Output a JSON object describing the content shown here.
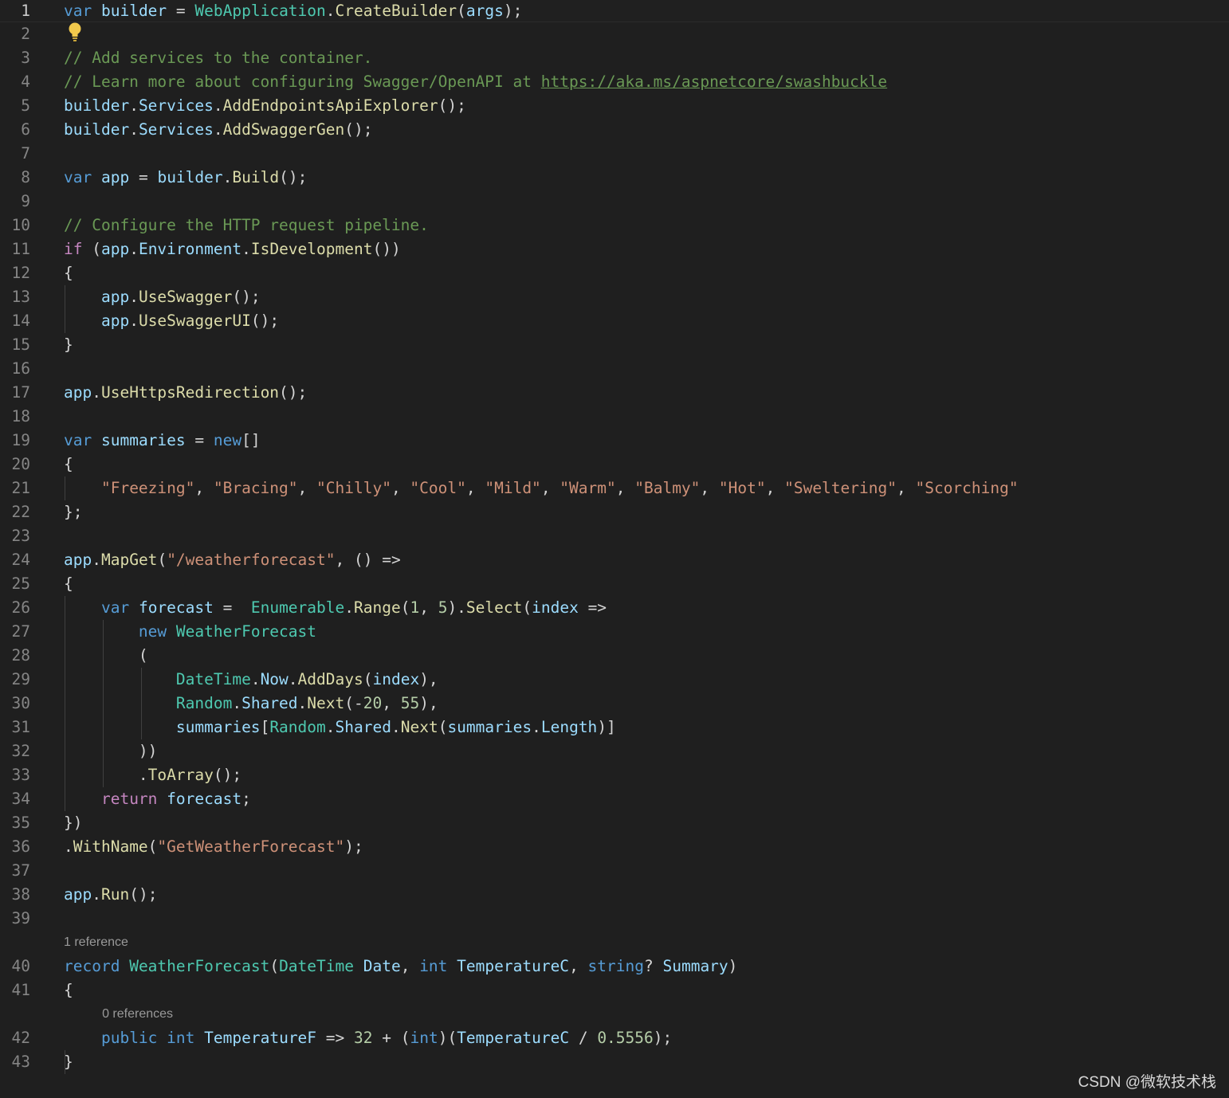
{
  "editor": {
    "language": "C#",
    "theme_colors": {
      "background": "#1f1f1f",
      "keyword": "#569cd6",
      "control": "#c586c0",
      "type": "#4ec9b0",
      "variable": "#9cdcfe",
      "function": "#dcdcaa",
      "string": "#ce9178",
      "number": "#b5cea8",
      "comment": "#6a9955",
      "punctuation": "#d4d4d4",
      "line_number": "#858585"
    },
    "current_line": 1,
    "lightbulb_icon": "lightbulb-icon",
    "lines": [
      {
        "n": "1",
        "tokens": [
          [
            "k",
            "var"
          ],
          [
            "p",
            " "
          ],
          [
            "v",
            "builder"
          ],
          [
            "p",
            " = "
          ],
          [
            "t",
            "WebApplication"
          ],
          [
            "p",
            "."
          ],
          [
            "f",
            "CreateBuilder"
          ],
          [
            "p",
            "("
          ],
          [
            "v",
            "args"
          ],
          [
            "p",
            ");"
          ]
        ]
      },
      {
        "n": "2",
        "tokens": []
      },
      {
        "n": "3",
        "tokens": [
          [
            "m",
            "// Add services to the container."
          ]
        ]
      },
      {
        "n": "4",
        "tokens": [
          [
            "m",
            "// Learn more about configuring Swagger/OpenAPI at "
          ],
          [
            "u",
            "https://aka.ms/aspnetcore/swashbuckle"
          ]
        ]
      },
      {
        "n": "5",
        "tokens": [
          [
            "v",
            "builder"
          ],
          [
            "p",
            "."
          ],
          [
            "v",
            "Services"
          ],
          [
            "p",
            "."
          ],
          [
            "f",
            "AddEndpointsApiExplorer"
          ],
          [
            "p",
            "();"
          ]
        ]
      },
      {
        "n": "6",
        "tokens": [
          [
            "v",
            "builder"
          ],
          [
            "p",
            "."
          ],
          [
            "v",
            "Services"
          ],
          [
            "p",
            "."
          ],
          [
            "f",
            "AddSwaggerGen"
          ],
          [
            "p",
            "();"
          ]
        ]
      },
      {
        "n": "7",
        "tokens": []
      },
      {
        "n": "8",
        "tokens": [
          [
            "k",
            "var"
          ],
          [
            "p",
            " "
          ],
          [
            "v",
            "app"
          ],
          [
            "p",
            " = "
          ],
          [
            "v",
            "builder"
          ],
          [
            "p",
            "."
          ],
          [
            "f",
            "Build"
          ],
          [
            "p",
            "();"
          ]
        ]
      },
      {
        "n": "9",
        "tokens": []
      },
      {
        "n": "10",
        "tokens": [
          [
            "m",
            "// Configure the HTTP request pipeline."
          ]
        ]
      },
      {
        "n": "11",
        "tokens": [
          [
            "c",
            "if"
          ],
          [
            "p",
            " ("
          ],
          [
            "v",
            "app"
          ],
          [
            "p",
            "."
          ],
          [
            "v",
            "Environment"
          ],
          [
            "p",
            "."
          ],
          [
            "f",
            "IsDevelopment"
          ],
          [
            "p",
            "())"
          ]
        ]
      },
      {
        "n": "12",
        "tokens": [
          [
            "p",
            "{"
          ]
        ]
      },
      {
        "n": "13",
        "tokens": [
          [
            "p",
            "    "
          ],
          [
            "v",
            "app"
          ],
          [
            "p",
            "."
          ],
          [
            "f",
            "UseSwagger"
          ],
          [
            "p",
            "();"
          ]
        ]
      },
      {
        "n": "14",
        "tokens": [
          [
            "p",
            "    "
          ],
          [
            "v",
            "app"
          ],
          [
            "p",
            "."
          ],
          [
            "f",
            "UseSwaggerUI"
          ],
          [
            "p",
            "();"
          ]
        ]
      },
      {
        "n": "15",
        "tokens": [
          [
            "p",
            "}"
          ]
        ]
      },
      {
        "n": "16",
        "tokens": []
      },
      {
        "n": "17",
        "tokens": [
          [
            "v",
            "app"
          ],
          [
            "p",
            "."
          ],
          [
            "f",
            "UseHttpsRedirection"
          ],
          [
            "p",
            "();"
          ]
        ]
      },
      {
        "n": "18",
        "tokens": []
      },
      {
        "n": "19",
        "tokens": [
          [
            "k",
            "var"
          ],
          [
            "p",
            " "
          ],
          [
            "v",
            "summaries"
          ],
          [
            "p",
            " = "
          ],
          [
            "k",
            "new"
          ],
          [
            "p",
            "[]"
          ]
        ]
      },
      {
        "n": "20",
        "tokens": [
          [
            "p",
            "{"
          ]
        ]
      },
      {
        "n": "21",
        "tokens": [
          [
            "p",
            "    "
          ],
          [
            "s",
            "\"Freezing\""
          ],
          [
            "p",
            ", "
          ],
          [
            "s",
            "\"Bracing\""
          ],
          [
            "p",
            ", "
          ],
          [
            "s",
            "\"Chilly\""
          ],
          [
            "p",
            ", "
          ],
          [
            "s",
            "\"Cool\""
          ],
          [
            "p",
            ", "
          ],
          [
            "s",
            "\"Mild\""
          ],
          [
            "p",
            ", "
          ],
          [
            "s",
            "\"Warm\""
          ],
          [
            "p",
            ", "
          ],
          [
            "s",
            "\"Balmy\""
          ],
          [
            "p",
            ", "
          ],
          [
            "s",
            "\"Hot\""
          ],
          [
            "p",
            ", "
          ],
          [
            "s",
            "\"Sweltering\""
          ],
          [
            "p",
            ", "
          ],
          [
            "s",
            "\"Scorching\""
          ]
        ]
      },
      {
        "n": "22",
        "tokens": [
          [
            "p",
            "};"
          ]
        ]
      },
      {
        "n": "23",
        "tokens": []
      },
      {
        "n": "24",
        "tokens": [
          [
            "v",
            "app"
          ],
          [
            "p",
            "."
          ],
          [
            "f",
            "MapGet"
          ],
          [
            "p",
            "("
          ],
          [
            "s",
            "\"/weatherforecast\""
          ],
          [
            "p",
            ", () =>"
          ]
        ]
      },
      {
        "n": "25",
        "tokens": [
          [
            "p",
            "{"
          ]
        ]
      },
      {
        "n": "26",
        "tokens": [
          [
            "p",
            "    "
          ],
          [
            "k",
            "var"
          ],
          [
            "p",
            " "
          ],
          [
            "v",
            "forecast"
          ],
          [
            "p",
            " =  "
          ],
          [
            "t",
            "Enumerable"
          ],
          [
            "p",
            "."
          ],
          [
            "f",
            "Range"
          ],
          [
            "p",
            "("
          ],
          [
            "n",
            "1"
          ],
          [
            "p",
            ", "
          ],
          [
            "n",
            "5"
          ],
          [
            "p",
            ")."
          ],
          [
            "f",
            "Select"
          ],
          [
            "p",
            "("
          ],
          [
            "v",
            "index"
          ],
          [
            "p",
            " =>"
          ]
        ]
      },
      {
        "n": "27",
        "tokens": [
          [
            "p",
            "        "
          ],
          [
            "k",
            "new"
          ],
          [
            "p",
            " "
          ],
          [
            "t",
            "WeatherForecast"
          ]
        ]
      },
      {
        "n": "28",
        "tokens": [
          [
            "p",
            "        ("
          ]
        ]
      },
      {
        "n": "29",
        "tokens": [
          [
            "p",
            "            "
          ],
          [
            "t",
            "DateTime"
          ],
          [
            "p",
            "."
          ],
          [
            "v",
            "Now"
          ],
          [
            "p",
            "."
          ],
          [
            "f",
            "AddDays"
          ],
          [
            "p",
            "("
          ],
          [
            "v",
            "index"
          ],
          [
            "p",
            "),"
          ]
        ]
      },
      {
        "n": "30",
        "tokens": [
          [
            "p",
            "            "
          ],
          [
            "t",
            "Random"
          ],
          [
            "p",
            "."
          ],
          [
            "v",
            "Shared"
          ],
          [
            "p",
            "."
          ],
          [
            "f",
            "Next"
          ],
          [
            "p",
            "(-"
          ],
          [
            "n",
            "20"
          ],
          [
            "p",
            ", "
          ],
          [
            "n",
            "55"
          ],
          [
            "p",
            "),"
          ]
        ]
      },
      {
        "n": "31",
        "tokens": [
          [
            "p",
            "            "
          ],
          [
            "v",
            "summaries"
          ],
          [
            "p",
            "["
          ],
          [
            "t",
            "Random"
          ],
          [
            "p",
            "."
          ],
          [
            "v",
            "Shared"
          ],
          [
            "p",
            "."
          ],
          [
            "f",
            "Next"
          ],
          [
            "p",
            "("
          ],
          [
            "v",
            "summaries"
          ],
          [
            "p",
            "."
          ],
          [
            "v",
            "Length"
          ],
          [
            "p",
            ")]"
          ]
        ]
      },
      {
        "n": "32",
        "tokens": [
          [
            "p",
            "        ))"
          ]
        ]
      },
      {
        "n": "33",
        "tokens": [
          [
            "p",
            "        ."
          ],
          [
            "f",
            "ToArray"
          ],
          [
            "p",
            "();"
          ]
        ]
      },
      {
        "n": "34",
        "tokens": [
          [
            "p",
            "    "
          ],
          [
            "c",
            "return"
          ],
          [
            "p",
            " "
          ],
          [
            "v",
            "forecast"
          ],
          [
            "p",
            ";"
          ]
        ]
      },
      {
        "n": "35",
        "tokens": [
          [
            "p",
            "})"
          ]
        ]
      },
      {
        "n": "36",
        "tokens": [
          [
            "p",
            "."
          ],
          [
            "f",
            "WithName"
          ],
          [
            "p",
            "("
          ],
          [
            "s",
            "\"GetWeatherForecast\""
          ],
          [
            "p",
            ");"
          ]
        ]
      },
      {
        "n": "37",
        "tokens": []
      },
      {
        "n": "38",
        "tokens": [
          [
            "v",
            "app"
          ],
          [
            "p",
            "."
          ],
          [
            "f",
            "Run"
          ],
          [
            "p",
            "();"
          ]
        ]
      },
      {
        "n": "39",
        "tokens": []
      },
      {
        "codelens": "1 reference",
        "indent": 0
      },
      {
        "n": "40",
        "tokens": [
          [
            "k",
            "record"
          ],
          [
            "p",
            " "
          ],
          [
            "t",
            "WeatherForecast"
          ],
          [
            "p",
            "("
          ],
          [
            "t",
            "DateTime"
          ],
          [
            "p",
            " "
          ],
          [
            "v",
            "Date"
          ],
          [
            "p",
            ", "
          ],
          [
            "k",
            "int"
          ],
          [
            "p",
            " "
          ],
          [
            "v",
            "TemperatureC"
          ],
          [
            "p",
            ", "
          ],
          [
            "k",
            "string"
          ],
          [
            "p",
            "? "
          ],
          [
            "v",
            "Summary"
          ],
          [
            "p",
            ")"
          ]
        ]
      },
      {
        "n": "41",
        "tokens": [
          [
            "p",
            "{"
          ]
        ]
      },
      {
        "codelens": "0 references",
        "indent": 4
      },
      {
        "n": "42",
        "tokens": [
          [
            "p",
            "    "
          ],
          [
            "k",
            "public"
          ],
          [
            "p",
            " "
          ],
          [
            "k",
            "int"
          ],
          [
            "p",
            " "
          ],
          [
            "v",
            "TemperatureF"
          ],
          [
            "p",
            " => "
          ],
          [
            "n",
            "32"
          ],
          [
            "p",
            " + ("
          ],
          [
            "k",
            "int"
          ],
          [
            "p",
            ")("
          ],
          [
            "v",
            "TemperatureC"
          ],
          [
            "p",
            " / "
          ],
          [
            "n",
            "0.5556"
          ],
          [
            "p",
            ");"
          ]
        ]
      },
      {
        "n": "43",
        "tokens": [
          [
            "p",
            "}"
          ]
        ]
      }
    ]
  },
  "watermark": "CSDN @微软技术栈"
}
